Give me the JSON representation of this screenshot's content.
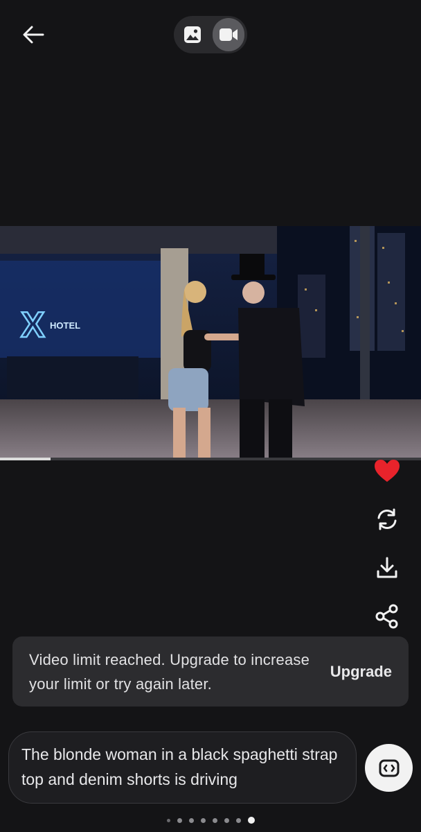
{
  "header": {
    "back_icon": "arrow-left-icon",
    "modes": [
      {
        "name": "image",
        "icon": "image-icon",
        "active": false
      },
      {
        "name": "video",
        "icon": "video-camera-icon",
        "active": true
      }
    ]
  },
  "video": {
    "scene_sign_text": "HOTEL",
    "progress_percent": 12
  },
  "actions": [
    {
      "name": "like",
      "icon": "heart-icon",
      "color": "#e8232b"
    },
    {
      "name": "regenerate",
      "icon": "refresh-icon"
    },
    {
      "name": "download",
      "icon": "download-icon"
    },
    {
      "name": "share",
      "icon": "share-icon"
    }
  ],
  "snackbar": {
    "message": "Video limit reached. Upgrade to increase your limit or try again later.",
    "action_label": "Upgrade"
  },
  "prompt": {
    "text": "The blonde woman in a black spaghetti strap top and denim shorts is driving",
    "expand_icon": "expand-icon"
  },
  "pagination": {
    "total": 8,
    "active_index": 7
  }
}
